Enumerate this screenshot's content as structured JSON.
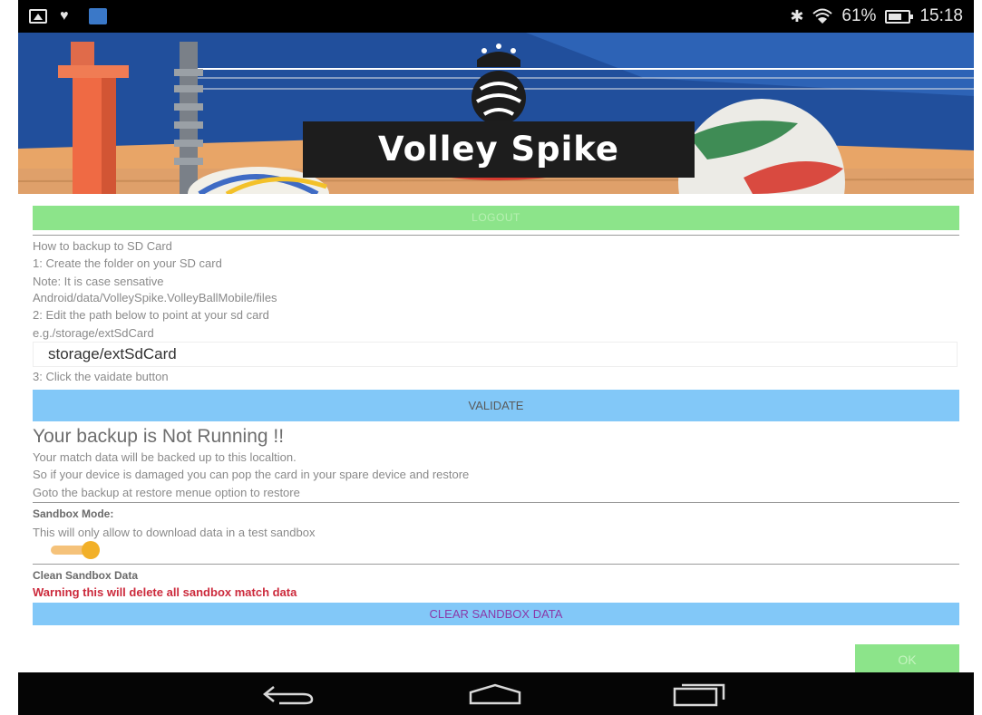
{
  "status_bar": {
    "battery": "61%",
    "time": "15:18"
  },
  "banner": {
    "brand": "Volley Spike"
  },
  "logout_label": "LOGOUT",
  "instructions": [
    "How to backup to SD Card",
    "1: Create the folder on your SD card",
    "Note: It is case sensative",
    "Android/data/VolleySpike.VolleyBallMobile/files",
    "2: Edit the path below to point at your sd card",
    "e.g./storage/extSdCard"
  ],
  "path_value": "storage/extSdCard",
  "step3": "3: Click the vaidate button",
  "validate_label": "VALIDATE",
  "backup_status": "Your backup is Not Running !!",
  "backup_info": [
    "Your match data will be backed up to this localtion.",
    "So if your device is damaged you can pop the card in your spare device and restore",
    "Goto the backup at restore menue option to restore"
  ],
  "sandbox": {
    "title": "Sandbox Mode:",
    "description": "This will only allow to download data in a test sandbox",
    "enabled": true
  },
  "clean": {
    "title": "Clean Sandbox Data",
    "warning": "Warning this will delete all sandbox match data",
    "button_label": "CLEAR SANDBOX DATA"
  },
  "ok_label": "OK",
  "colors": {
    "green_button": "#8ce48a",
    "blue_button": "#82c8f8",
    "warning": "#cc2a3c",
    "toggle": "#f2b028"
  }
}
